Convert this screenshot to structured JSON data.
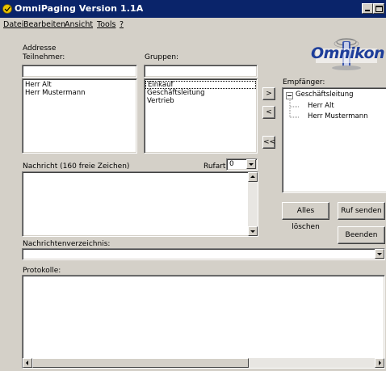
{
  "window": {
    "title": "OmniPaging Version 1.1A"
  },
  "menu": [
    {
      "label": "Datei",
      "accel": "D"
    },
    {
      "label": "Bearbeiten",
      "accel": "B"
    },
    {
      "label": "Ansicht",
      "accel": "A"
    },
    {
      "label": "Tools",
      "accel": "T"
    },
    {
      "label": "?",
      "accel": "?"
    }
  ],
  "address": {
    "group_label": "Addresse",
    "teilnehmer_label": "Teilnehmer:",
    "gruppen_label": "Gruppen:",
    "teilnehmer_search": "",
    "gruppen_search": "",
    "teilnehmer_items": [
      "Herr Alt",
      "Herr Mustermann"
    ],
    "gruppen_items": [
      "Einkauf",
      "Geschäftsleitung",
      "Vertrieb"
    ],
    "gruppen_selected": "Einkauf"
  },
  "transfer": {
    "add_label": ">",
    "remove_label": "<",
    "remove_all_label": "<<"
  },
  "logo": {
    "text": "Omnikon",
    "color": "#1e3e9a"
  },
  "recipients": {
    "label": "Empfänger:",
    "tree": {
      "root": "Geschäftsleitung",
      "children": [
        "Herr Alt",
        "Herr Mustermann"
      ]
    }
  },
  "message": {
    "label": "Nachricht (160 freie Zeichen)",
    "rufart_label": "Rufart:",
    "rufart_value": "0",
    "text": ""
  },
  "actions": {
    "clear_all": "Alles löschen",
    "send": "Ruf senden",
    "quit": "Beenden"
  },
  "directory": {
    "label": "Nachrichtenverzeichnis:",
    "value": ""
  },
  "protocols": {
    "label": "Protokolle:",
    "text": ""
  },
  "colors": {
    "titlebar": "#0a246a",
    "face": "#d4d0c8",
    "accent_icon": "#e8c400"
  }
}
